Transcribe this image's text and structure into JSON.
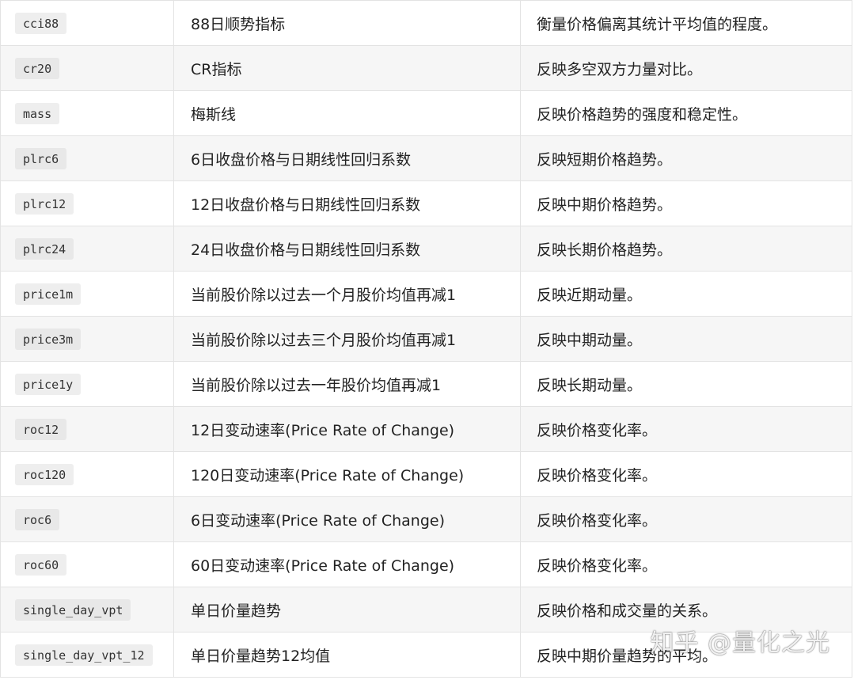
{
  "rows": [
    {
      "name": "cci88",
      "desc": "88日顺势指标",
      "meaning": "衡量价格偏离其统计平均值的程度。"
    },
    {
      "name": "cr20",
      "desc": "CR指标",
      "meaning": "反映多空双方力量对比。"
    },
    {
      "name": "mass",
      "desc": "梅斯线",
      "meaning": "反映价格趋势的强度和稳定性。"
    },
    {
      "name": "plrc6",
      "desc": "6日收盘价格与日期线性回归系数",
      "meaning": "反映短期价格趋势。"
    },
    {
      "name": "plrc12",
      "desc": "12日收盘价格与日期线性回归系数",
      "meaning": "反映中期价格趋势。"
    },
    {
      "name": "plrc24",
      "desc": "24日收盘价格与日期线性回归系数",
      "meaning": "反映长期价格趋势。"
    },
    {
      "name": "price1m",
      "desc": "当前股价除以过去一个月股价均值再减1",
      "meaning": "反映近期动量。"
    },
    {
      "name": "price3m",
      "desc": "当前股价除以过去三个月股价均值再减1",
      "meaning": "反映中期动量。"
    },
    {
      "name": "price1y",
      "desc": "当前股价除以过去一年股价均值再减1",
      "meaning": "反映长期动量。"
    },
    {
      "name": "roc12",
      "desc": "12日变动速率(Price Rate of Change)",
      "meaning": "反映价格变化率。"
    },
    {
      "name": "roc120",
      "desc": "120日变动速率(Price Rate of Change)",
      "meaning": "反映价格变化率。"
    },
    {
      "name": "roc6",
      "desc": "6日变动速率(Price Rate of Change)",
      "meaning": "反映价格变化率。"
    },
    {
      "name": "roc60",
      "desc": "60日变动速率(Price Rate of Change)",
      "meaning": "反映价格变化率。"
    },
    {
      "name": "single_day_vpt",
      "desc": "单日价量趋势",
      "meaning": "反映价格和成交量的关系。"
    },
    {
      "name": "single_day_vpt_12",
      "desc": "单日价量趋势12均值",
      "meaning": "反映中期价量趋势的平均。"
    }
  ],
  "watermark": "知乎 @量化之光"
}
